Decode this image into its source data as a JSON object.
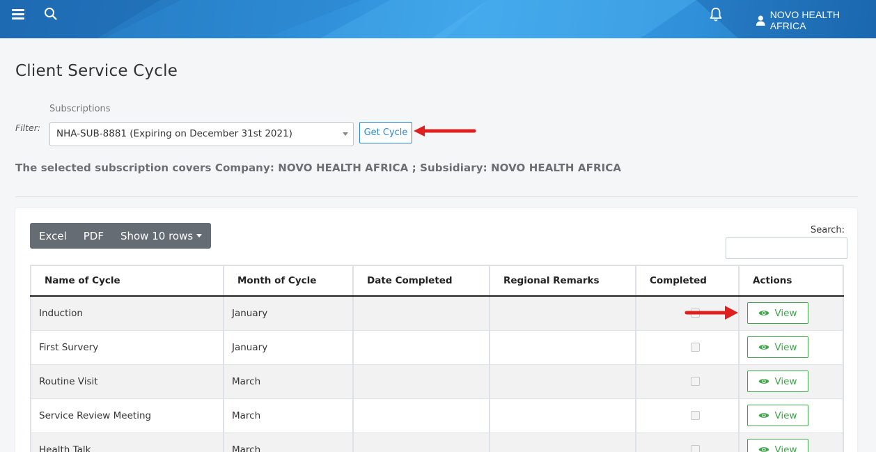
{
  "topbar": {
    "user_name": "NOVO HEALTH AFRICA"
  },
  "page": {
    "title": "Client Service Cycle",
    "filter_label": "Filter:",
    "subscriptions_label": "Subscriptions",
    "subscription_selected": "NHA-SUB-8881 (Expiring on December 31st 2021)",
    "get_cycle_label": "Get Cycle",
    "coverage_text": "The selected subscription covers Company: NOVO HEALTH AFRICA ; Subsidiary: NOVO HEALTH AFRICA"
  },
  "toolbar": {
    "excel": "Excel",
    "pdf": "PDF",
    "show_rows": "Show 10 rows",
    "search_label": "Search:"
  },
  "table": {
    "columns": [
      "Name of Cycle",
      "Month of Cycle",
      "Date Completed",
      "Regional Remarks",
      "Completed",
      "Actions"
    ],
    "view_label": "View",
    "rows": [
      {
        "name": "Induction",
        "month": "January",
        "date": "",
        "remarks": ""
      },
      {
        "name": "First Survery",
        "month": "January",
        "date": "",
        "remarks": ""
      },
      {
        "name": "Routine Visit",
        "month": "March",
        "date": "",
        "remarks": ""
      },
      {
        "name": "Service Review Meeting",
        "month": "March",
        "date": "",
        "remarks": ""
      },
      {
        "name": "Health Talk",
        "month": "March",
        "date": "",
        "remarks": ""
      }
    ]
  },
  "colors": {
    "header_blue": "#2f8fd8",
    "link_blue": "#2c89d1",
    "view_green": "#3ea54a",
    "annotation_red": "#e0201f"
  },
  "icons": [
    "hamburger-icon",
    "search-icon",
    "bell-icon",
    "user-icon",
    "eye-icon",
    "caret-down-icon"
  ]
}
